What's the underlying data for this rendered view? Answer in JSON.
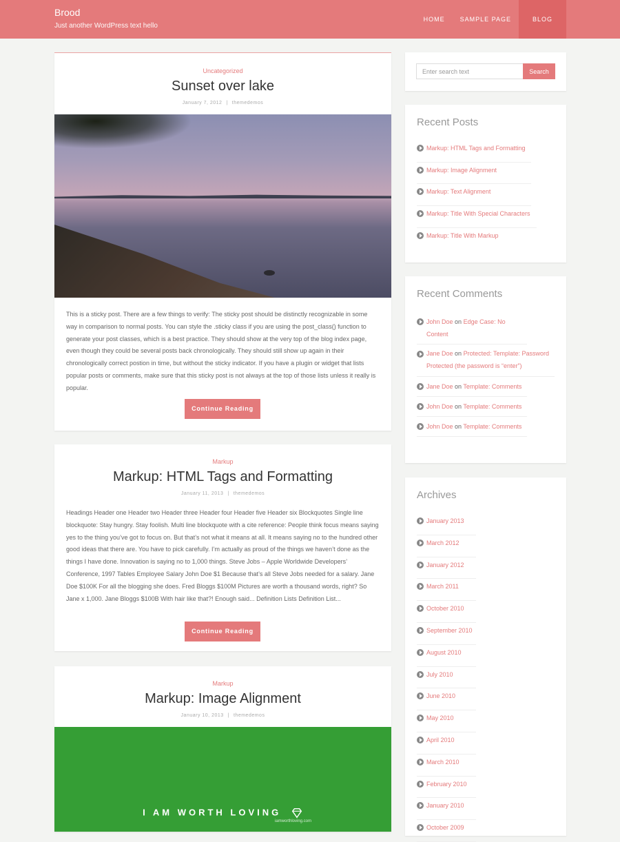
{
  "header": {
    "site_title": "Brood",
    "site_description": "Just another WordPress text hello",
    "nav": [
      "HOME",
      "SAMPLE PAGE",
      "BLOG"
    ],
    "active_nav": "BLOG"
  },
  "posts": [
    {
      "category": "Uncategorized",
      "title": "Sunset over lake",
      "date": "January 7, 2012",
      "author": "themedemos",
      "excerpt": "This is a sticky post. There are a few things to verify: The sticky post should be distinctly recognizable in some way in comparison to normal posts. You can style the .sticky class if you are using the post_class() function to generate your post classes, which is a best practice. They should show at the very top of the blog index page, even though they could be several posts back chronologically. They should still show up again in their chronologically correct postion in time, but without the sticky indicator. If you have a plugin or widget that lists popular posts or comments, make sure that this sticky post is not always at the top of those lists unless it really is popular.",
      "button": "Continue Reading"
    },
    {
      "category": "Markup",
      "title": "Markup: HTML Tags and Formatting",
      "date": "January 11, 2013",
      "author": "themedemos",
      "excerpt": "Headings Header one Header two Header three Header four Header five Header six Blockquotes Single line blockquote: Stay hungry. Stay foolish. Multi line blockquote with a cite reference: People think focus means saying yes to the thing you’ve got to focus on. But that’s not what it means at all. It means saying no to the hundred other good ideas that there are. You have to pick carefully. I’m actually as proud of the things we haven’t done as the things I have done. Innovation is saying no to 1,000 things. Steve Jobs – Apple Worldwide Developers’ Conference, 1997 Tables Employee Salary John Doe $1 Because that’s all Steve Jobs needed for a salary. Jane Doe $100K For all the blogging she does. Fred Bloggs $100M Pictures are worth a thousand words, right? So Jane x 1,000. Jane Bloggs $100B With hair like that?! Enough said... Definition Lists Definition List...",
      "button": "Continue Reading"
    },
    {
      "category": "Markup",
      "title": "Markup: Image Alignment",
      "date": "January 10, 2013",
      "author": "themedemos",
      "image_text": "I AM WORTH LOVING",
      "image_subtext": "iamworthloving.com"
    }
  ],
  "meta_separator": "|",
  "search": {
    "placeholder": "Enter search text",
    "button": "Search"
  },
  "recent_posts": {
    "title": "Recent Posts",
    "items": [
      "Markup: HTML Tags and Formatting",
      "Markup: Image Alignment",
      "Markup: Text Alignment",
      "Markup: Title With Special Characters",
      "Markup: Title With Markup"
    ]
  },
  "recent_comments": {
    "title": "Recent Comments",
    "on_word": "on",
    "items": [
      {
        "author": "John Doe",
        "post": "Edge Case: No Content"
      },
      {
        "author": "Jane Doe",
        "post": "Protected: Template: Password Protected (the password is “enter”)"
      },
      {
        "author": "Jane Doe",
        "post": "Template: Comments"
      },
      {
        "author": "John Doe",
        "post": "Template: Comments"
      },
      {
        "author": "John Doe",
        "post": "Template: Comments"
      }
    ]
  },
  "archives": {
    "title": "Archives",
    "items": [
      "January 2013",
      "March 2012",
      "January 2012",
      "March 2011",
      "October 2010",
      "September 2010",
      "August 2010",
      "July 2010",
      "June 2010",
      "May 2010",
      "April 2010",
      "March 2010",
      "February 2010",
      "January 2010",
      "October 2009"
    ]
  },
  "colors": {
    "accent": "#e47a7b",
    "header_active": "#dd6566",
    "background": "#f3f4f2",
    "green_image": "#359e35"
  }
}
